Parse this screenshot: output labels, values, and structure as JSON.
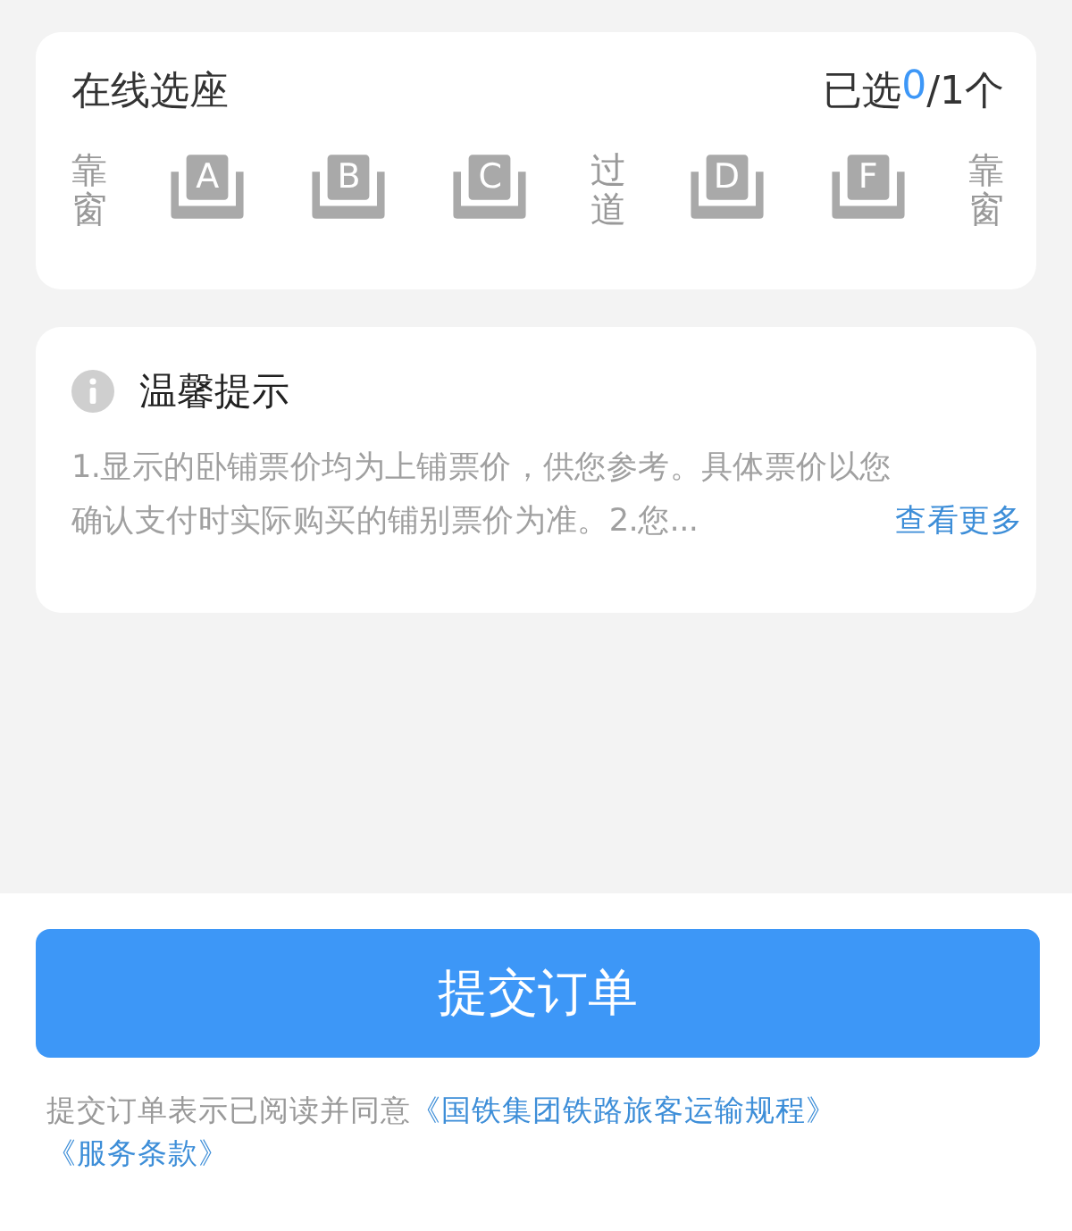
{
  "seat_card": {
    "title": "在线选座",
    "count_prefix": "已选",
    "count_selected": "0",
    "count_suffix": "/1个",
    "row": [
      {
        "kind": "label",
        "text": "靠窗"
      },
      {
        "kind": "seat",
        "letter": "A",
        "selected": false
      },
      {
        "kind": "seat",
        "letter": "B",
        "selected": false
      },
      {
        "kind": "seat",
        "letter": "C",
        "selected": false
      },
      {
        "kind": "label",
        "text": "过道"
      },
      {
        "kind": "seat",
        "letter": "D",
        "selected": false
      },
      {
        "kind": "seat",
        "letter": "F",
        "selected": false
      },
      {
        "kind": "label",
        "text": "靠窗"
      }
    ]
  },
  "tips": {
    "title": "温馨提示",
    "text": "1.显示的卧铺票价均为上铺票价，供您参考。具体票价以您确认支付时实际购买的铺别票价为准。2.您...",
    "more": "查看更多"
  },
  "submit": {
    "label": "提交订单",
    "agreement": "提交订单表示已阅读并同意",
    "links": [
      "《国铁集团铁路旅客运输规程》",
      "《服务条款》"
    ]
  }
}
